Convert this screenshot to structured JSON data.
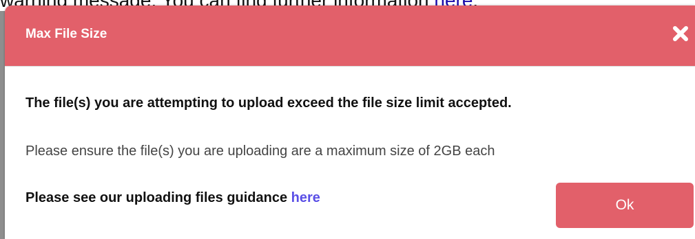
{
  "background": {
    "text": "warning message. You can find further information ",
    "link_text": "here",
    "link_suffix": "."
  },
  "modal": {
    "title": "Max File Size",
    "close_icon": "close-icon",
    "line_bold": "The file(s) you are attempting to upload exceed the file size limit accepted.",
    "line_normal": "Please ensure the file(s) you are uploading are a maximum size of 2GB each",
    "guidance_text": "Please see our uploading files guidance ",
    "guidance_link": "here",
    "ok_label": "Ok"
  },
  "colors": {
    "header": "#e2606a",
    "button": "#e2606a",
    "link": "#5a4fe6",
    "overlay": "#8e8e8e"
  }
}
